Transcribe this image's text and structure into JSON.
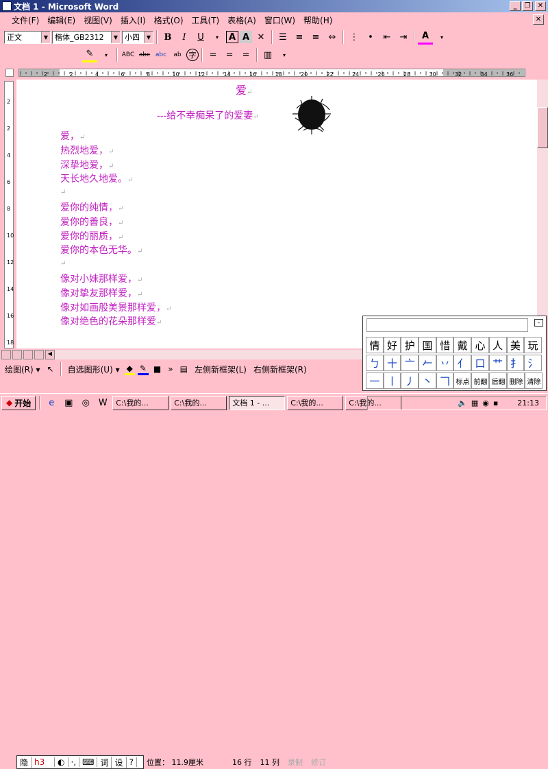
{
  "window": {
    "title": "文档 1 - Microsoft Word"
  },
  "menu": [
    "文件(F)",
    "编辑(E)",
    "视图(V)",
    "插入(I)",
    "格式(O)",
    "工具(T)",
    "表格(A)",
    "窗口(W)",
    "帮助(H)"
  ],
  "format": {
    "style": "正文",
    "font": "楷体_GB2312",
    "size": "小四"
  },
  "ruler": {
    "ticks": [
      "2",
      "2",
      "4",
      "6",
      "8",
      "10",
      "12",
      "14",
      "16",
      "18",
      "20",
      "22",
      "24",
      "26",
      "28",
      "30",
      "32",
      "34",
      "36"
    ]
  },
  "vruler": {
    "ticks": [
      "2",
      "2",
      "4",
      "6",
      "8",
      "10",
      "12",
      "14",
      "16",
      "18"
    ]
  },
  "document": {
    "title": "爱",
    "subtitle": "---给不幸痴呆了的爱妻",
    "lines": [
      "爱，",
      "热烈地爱，",
      "深挚地爱，",
      "天长地久地爱。",
      "",
      "爱你的纯情，",
      "爱你的善良，",
      "爱你的丽质，",
      "爱你的本色无华。",
      "",
      "像对小妹那样爱，",
      "像对挚友那样爱，",
      "像对如画般美景那样爱，",
      "像对绝色的花朵那样爱"
    ]
  },
  "drawing": {
    "draw_label": "绘图(R)",
    "autoshape_label": "自选图形(U)",
    "left_frame": "左侧新框架(L)",
    "right_frame": "右侧新框架(R)"
  },
  "ime": {
    "hide": "隐",
    "code": "h3",
    "word": "词",
    "settings": "设"
  },
  "status": {
    "position": "位置： 11.9厘米",
    "row": "16 行",
    "col": "11 列",
    "rec": "录制",
    "trk": "修订"
  },
  "handwriting": {
    "candidates": [
      "情",
      "好",
      "护",
      "国",
      "惜",
      "戴",
      "心",
      "人",
      "美",
      "玩"
    ],
    "strokes1": [
      "ㄅ",
      "十",
      "亠",
      "𠂉",
      "丷",
      "亻",
      "口",
      "艹",
      "扌",
      "氵"
    ],
    "strokes2": [
      "一",
      "丨",
      "丿",
      "丶",
      "𠃍"
    ],
    "controls": [
      "标点",
      "前翻",
      "后翻",
      "删除",
      "清除"
    ]
  },
  "taskbar": {
    "start": "开始",
    "tasks": [
      "C:\\我的...",
      "C:\\我的...",
      "文档 1 - ...",
      "C:\\我的...",
      "C:\\我的..."
    ],
    "clock": "21:13"
  }
}
